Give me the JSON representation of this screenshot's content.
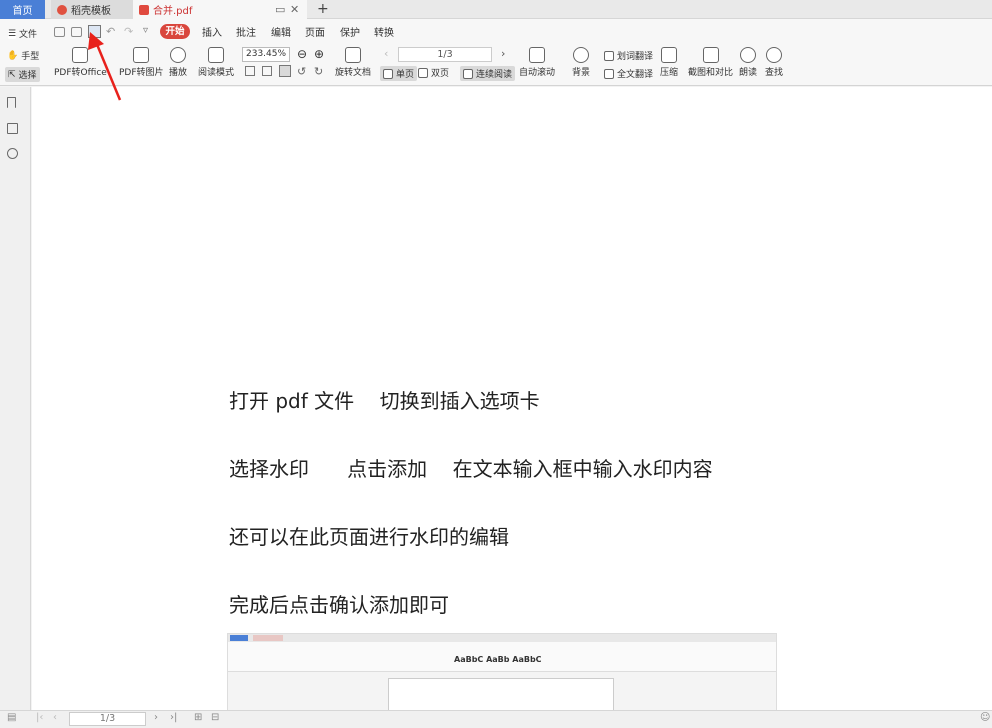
{
  "tabs": {
    "home": "首页",
    "template": "稻壳模板",
    "pdf": "合并.pdf"
  },
  "quickbar": {
    "file": "文件"
  },
  "menu": {
    "start": "开始",
    "insert": "插入",
    "annotate": "批注",
    "edit": "编辑",
    "page": "页面",
    "protect": "保护",
    "convert": "转换"
  },
  "tools": {
    "hand": "手型",
    "select": "选择",
    "pdf_to_office": "PDF转Office",
    "pdf_to_image": "PDF转图片",
    "play": "播放",
    "read_mode": "阅读模式",
    "zoom": "233.45%",
    "rotate": "旋转文档",
    "page_indicator": "1/3",
    "single": "单页",
    "double": "双页",
    "continuous": "连续阅读",
    "auto_scroll": "自动滚动",
    "background": "背景",
    "word_translate": "划词翻译",
    "full_translate": "全文翻译",
    "compress": "压缩",
    "screenshot_compare": "截图和对比",
    "read_aloud": "朗读",
    "find": "查找"
  },
  "document": {
    "line1": "打开 pdf 文件    切换到插入选项卡",
    "line2": "选择水印      点击添加    在文本输入框中输入水印内容",
    "line3": "还可以在此页面进行水印的编辑",
    "line4": "完成后点击确认添加即可"
  },
  "thumbnail": {
    "sample_text": "AaBbC AaBb AaBbC"
  },
  "statusbar": {
    "page": "1/3"
  },
  "colors": {
    "accent": "#4a7fd6",
    "start_tab": "#d9463d",
    "arrow": "#e8211c"
  }
}
